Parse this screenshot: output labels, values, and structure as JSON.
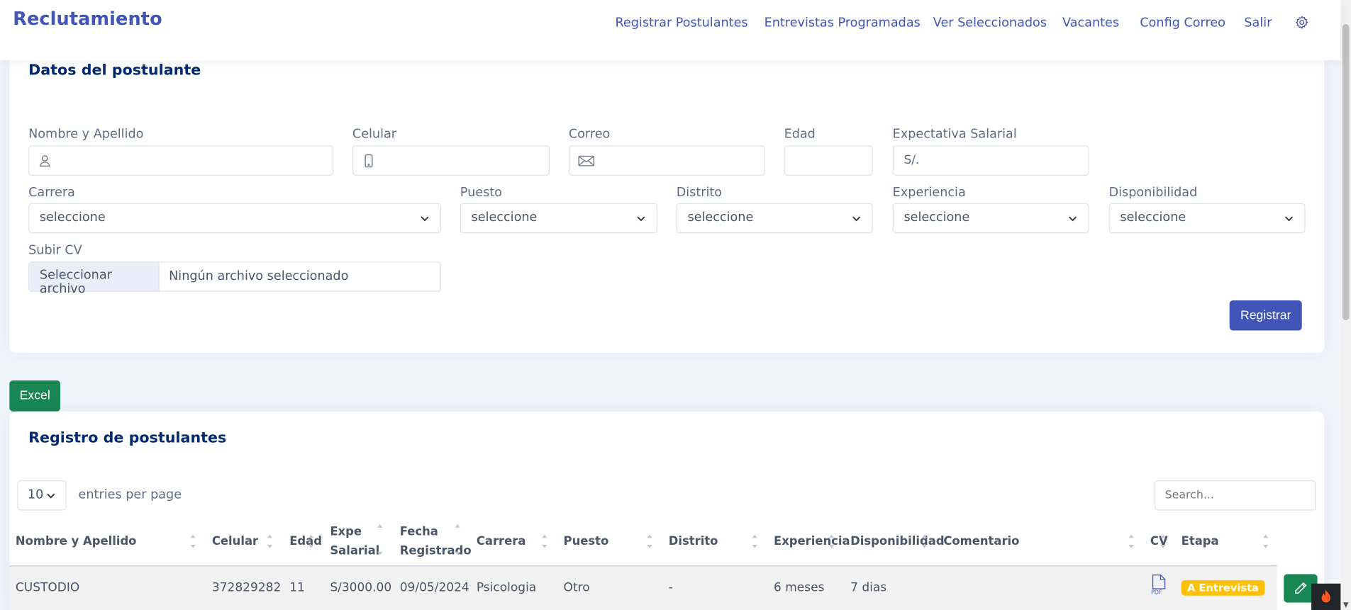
{
  "app": {
    "brand": "Reclutamiento"
  },
  "nav": {
    "items": [
      "Registrar Postulantes",
      "Entrevistas Programadas",
      "Ver Seleccionados",
      "Vacantes",
      "Config Correo",
      "Salir"
    ],
    "settings_icon": "gear-icon"
  },
  "form": {
    "title": "Datos del postulante",
    "labels": {
      "nombre": "Nombre y Apellido",
      "celular": "Celular",
      "correo": "Correo",
      "edad": "Edad",
      "expectativa": "Expectativa Salarial",
      "carrera": "Carrera",
      "puesto": "Puesto",
      "distrito": "Distrito",
      "experiencia": "Experiencia",
      "disponibilidad": "Disponibilidad",
      "cv": "Subir CV"
    },
    "values": {
      "nombre": "",
      "celular": "",
      "correo": "",
      "edad": "",
      "expectativa_placeholder": "S/.",
      "carrera": "seleccione",
      "puesto": "seleccione",
      "distrito": "seleccione",
      "experiencia": "seleccione",
      "disponibilidad": "seleccione"
    },
    "file": {
      "button": "Seleccionar archivo",
      "status": "Ningún archivo seleccionado"
    },
    "submit": "Registrar"
  },
  "excel_button": "Excel",
  "table": {
    "title": "Registro de postulantes",
    "page_size": "10",
    "page_size_label": "entries per page",
    "search_placeholder": "Search...",
    "columns": {
      "nombre": "Nombre y Apellido",
      "celular": "Celular",
      "edad": "Edad",
      "expe_1": "Expe",
      "expe_2": "Salarial",
      "fecha_1": "Fecha",
      "fecha_2": "Registrado",
      "carrera": "Carrera",
      "puesto": "Puesto",
      "distrito": "Distrito",
      "experiencia": "Experiencia",
      "disponibilidad": "Disponibilidad",
      "comentario": "Comentario",
      "cv": "CV",
      "etapa": "Etapa"
    },
    "rows": [
      {
        "nombre": "CUSTODIO",
        "celular": "372829282",
        "edad": "11",
        "salarial": "S/3000.00",
        "fecha": "09/05/2024",
        "carrera": "Psicologia",
        "puesto": "Otro",
        "distrito": "-",
        "experiencia": "6 meses",
        "disponibilidad": "7 dias",
        "comentario": "",
        "cv_icon": "pdf-icon",
        "etapa": "A Entrevista",
        "etapa_color": "#ffc107"
      }
    ]
  },
  "colors": {
    "primary": "#4154b8",
    "success": "#198754",
    "warning": "#ffc107",
    "heading": "#012970"
  }
}
